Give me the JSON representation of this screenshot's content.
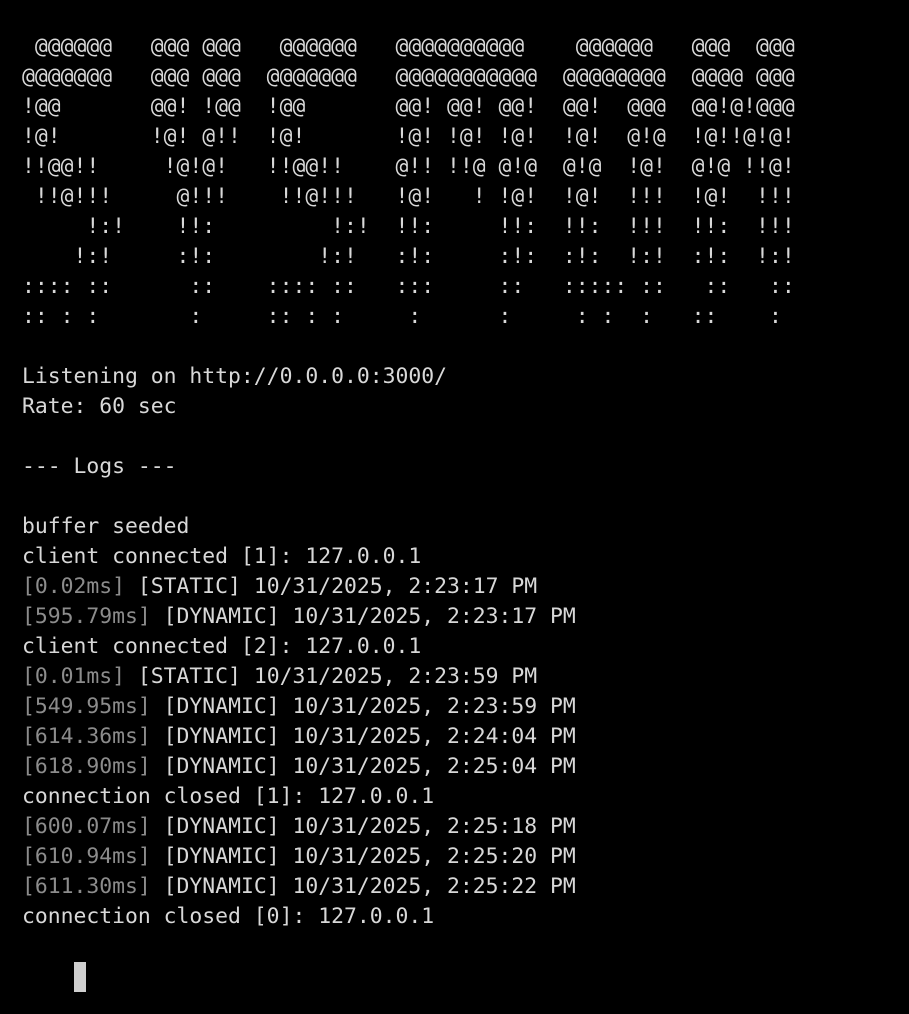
{
  "banner": [
    " @@@@@@   @@@ @@@   @@@@@@   @@@@@@@@@@    @@@@@@   @@@  @@@",
    "@@@@@@@   @@@ @@@  @@@@@@@   @@@@@@@@@@@  @@@@@@@@  @@@@ @@@",
    "!@@       @@! !@@  !@@       @@! @@! @@!  @@!  @@@  @@!@!@@@",
    "!@!       !@! @!!  !@!       !@! !@! !@!  !@!  @!@  !@!!@!@!",
    "!!@@!!     !@!@!   !!@@!!    @!! !!@ @!@  @!@  !@!  @!@ !!@!",
    " !!@!!!     @!!!    !!@!!!   !@!   ! !@!  !@!  !!!  !@!  !!!",
    "     !:!    !!:         !:!  !!:     !!:  !!:  !!!  !!:  !!!",
    "    !:!     :!:        !:!   :!:     :!:  :!:  !:!  :!:  !:!",
    ":::: ::      ::    :::: ::   :::     ::   ::::: ::   ::   ::",
    ":: : :       :     :: : :     :      :     : :  :   ::    :"
  ],
  "status": {
    "listening": "Listening on http://0.0.0.0:3000/",
    "rate": "Rate: 60 sec"
  },
  "logs_header": "--- Logs ---",
  "logs": [
    {
      "plain": "buffer seeded"
    },
    {
      "plain": "client connected [1]: 127.0.0.1"
    },
    {
      "timing": "[0.02ms]",
      "rest": " [STATIC] 10/31/2025, 2:23:17 PM"
    },
    {
      "timing": "[595.79ms]",
      "rest": " [DYNAMIC] 10/31/2025, 2:23:17 PM"
    },
    {
      "plain": "client connected [2]: 127.0.0.1"
    },
    {
      "timing": "[0.01ms]",
      "rest": " [STATIC] 10/31/2025, 2:23:59 PM"
    },
    {
      "timing": "[549.95ms]",
      "rest": " [DYNAMIC] 10/31/2025, 2:23:59 PM"
    },
    {
      "timing": "[614.36ms]",
      "rest": " [DYNAMIC] 10/31/2025, 2:24:04 PM"
    },
    {
      "timing": "[618.90ms]",
      "rest": " [DYNAMIC] 10/31/2025, 2:25:04 PM"
    },
    {
      "plain": "connection closed [1]: 127.0.0.1"
    },
    {
      "timing": "[600.07ms]",
      "rest": " [DYNAMIC] 10/31/2025, 2:25:18 PM"
    },
    {
      "timing": "[610.94ms]",
      "rest": " [DYNAMIC] 10/31/2025, 2:25:20 PM"
    },
    {
      "timing": "[611.30ms]",
      "rest": " [DYNAMIC] 10/31/2025, 2:25:22 PM"
    },
    {
      "plain": "connection closed [0]: 127.0.0.1"
    }
  ],
  "colors": {
    "background": "#000000",
    "text": "#d8d8d8",
    "timing": "#8c8c8c",
    "cursor": "#cfcfcf"
  }
}
